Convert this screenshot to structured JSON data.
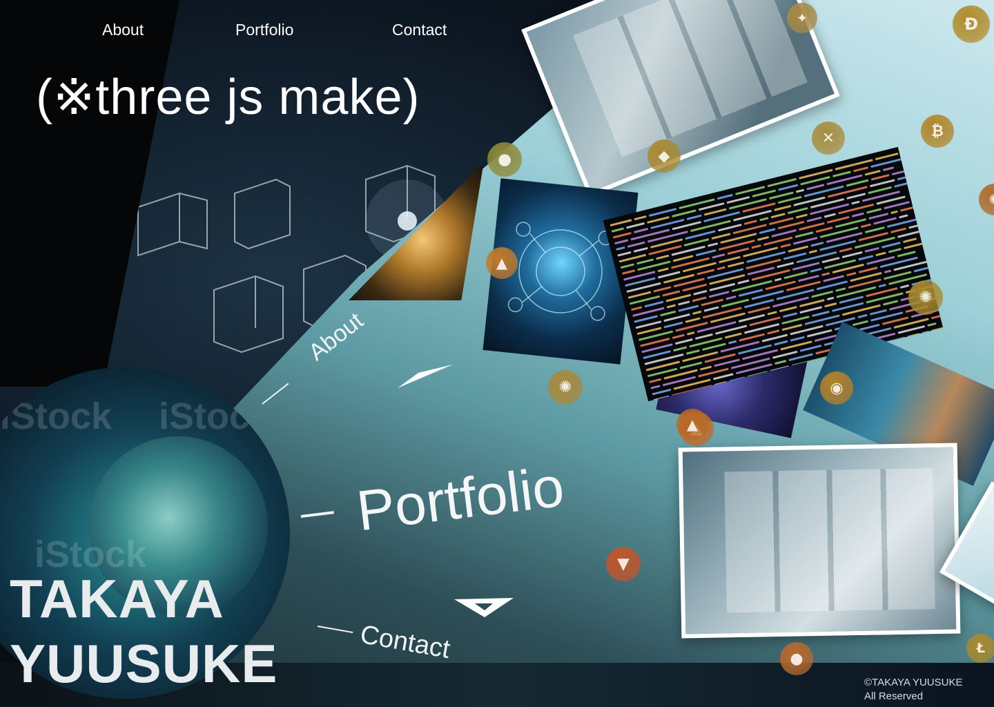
{
  "nav": {
    "about": "About",
    "portfolio": "Portfolio",
    "contact": "Contact"
  },
  "hero": {
    "headline": "(※three js make)"
  },
  "menu": {
    "about": "About",
    "portfolio": "Portfolio",
    "contact": "Contact"
  },
  "owner": {
    "name_line1": "TAKAYA",
    "name_line2": "YUUSUKE"
  },
  "footer": {
    "copyright": "©TAKAYA YUUSUKE",
    "rights": "All Reserved"
  },
  "watermark": "iStock",
  "colors": {
    "accent_cyan": "#9ccfd7",
    "coin_gold": "#b58a2a",
    "coin_orange": "#c8652a"
  },
  "coins": [
    {
      "icon": "stellar-coin-icon",
      "glyph": "✦",
      "color": "#a68a45"
    },
    {
      "icon": "dogecoin-icon",
      "glyph": "Ð",
      "color": "#b08c2c"
    },
    {
      "icon": "ripple-coin-icon",
      "glyph": "✕",
      "color": "#a88d3f"
    },
    {
      "icon": "bitcoin-icon",
      "glyph": "₿",
      "color": "#b0862b"
    },
    {
      "icon": "ethereum-icon",
      "glyph": "◆",
      "color": "#a98a31"
    },
    {
      "icon": "generic-coin-icon",
      "glyph": "●",
      "color": "#8e8a3a"
    },
    {
      "icon": "arrow-coin-icon",
      "glyph": "▲",
      "color": "#c27a2c"
    },
    {
      "icon": "avalanche-coin-icon",
      "glyph": "▲",
      "color": "#c06b2a"
    },
    {
      "icon": "cosmos-coin-icon",
      "glyph": "✺",
      "color": "#a78a32"
    },
    {
      "icon": "cardano-coin-icon",
      "glyph": "✺",
      "color": "#a8893b"
    },
    {
      "icon": "avalanche-coin-icon",
      "glyph": "▲",
      "color": "#b86a26"
    },
    {
      "icon": "shiba-coin-icon",
      "glyph": "◉",
      "color": "#b3822c"
    },
    {
      "icon": "tron-coin-icon",
      "glyph": "▼",
      "color": "#c0572a"
    },
    {
      "icon": "polkadot-coin-icon",
      "glyph": "✺",
      "color": "#b06a2c"
    },
    {
      "icon": "litecoin-icon",
      "glyph": "Ł",
      "color": "#a9892f"
    },
    {
      "icon": "edge-coin-icon",
      "glyph": "●",
      "color": "#b56a2e"
    }
  ]
}
